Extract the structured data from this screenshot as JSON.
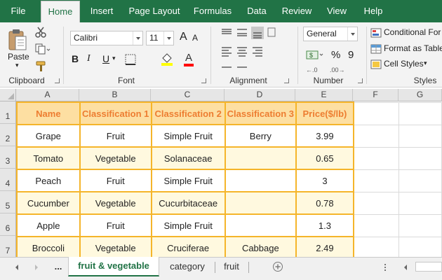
{
  "ribbon_tabs": [
    "File",
    "Home",
    "Insert",
    "Page Layout",
    "Formulas",
    "Data",
    "Review",
    "View",
    "Help"
  ],
  "active_tab": "Home",
  "clipboard": {
    "paste_label": "Paste",
    "group_label": "Clipboard"
  },
  "font": {
    "name": "Calibri",
    "size": "11",
    "group_label": "Font",
    "bold_label": "B",
    "italic_label": "I",
    "underline_label": "U",
    "grow_label": "A",
    "shrink_label": "A",
    "font_color_label": "A"
  },
  "alignment": {
    "group_label": "Alignment"
  },
  "number": {
    "format": "General",
    "group_label": "Number",
    "currency_label": "$",
    "percent_label": "%",
    "comma_label": "9"
  },
  "styles": {
    "conditional_formatting": "Conditional For",
    "format_as_table": "Format as Table",
    "cell_styles": "Cell Styles",
    "group_label": "Styles"
  },
  "columns": [
    "A",
    "B",
    "C",
    "D",
    "E",
    "F",
    "G"
  ],
  "rows": [
    "1",
    "2",
    "3",
    "4",
    "5",
    "6",
    "7"
  ],
  "table": {
    "headers": [
      "Name",
      "Classification 1",
      "Classification 2",
      "Classification 3",
      "Price($/lb)"
    ],
    "rows": [
      [
        "Grape",
        "Fruit",
        "Simple Fruit",
        "Berry",
        "3.99"
      ],
      [
        "Tomato",
        "Vegetable",
        "Solanaceae",
        "",
        "0.65"
      ],
      [
        "Peach",
        "Fruit",
        "Simple Fruit",
        "",
        "3"
      ],
      [
        "Cucumber",
        "Vegetable",
        "Cucurbitaceae",
        "",
        "0.78"
      ],
      [
        "Apple",
        "Fruit",
        "Simple Fruit",
        "",
        "1.3"
      ],
      [
        "Broccoli",
        "Vegetable",
        "Cruciferae",
        "Cabbage",
        "2.49"
      ]
    ]
  },
  "sheet_tabs": {
    "ellipsis": "...",
    "items": [
      "fruit & vegetable",
      "category",
      "fruit"
    ],
    "active": "fruit & vegetable"
  },
  "colors": {
    "excel_green": "#217346",
    "table_border": "#f5b52a",
    "header_fill": "#fddfa2",
    "header_text": "#ed7d31",
    "band_fill": "#fff9df"
  }
}
